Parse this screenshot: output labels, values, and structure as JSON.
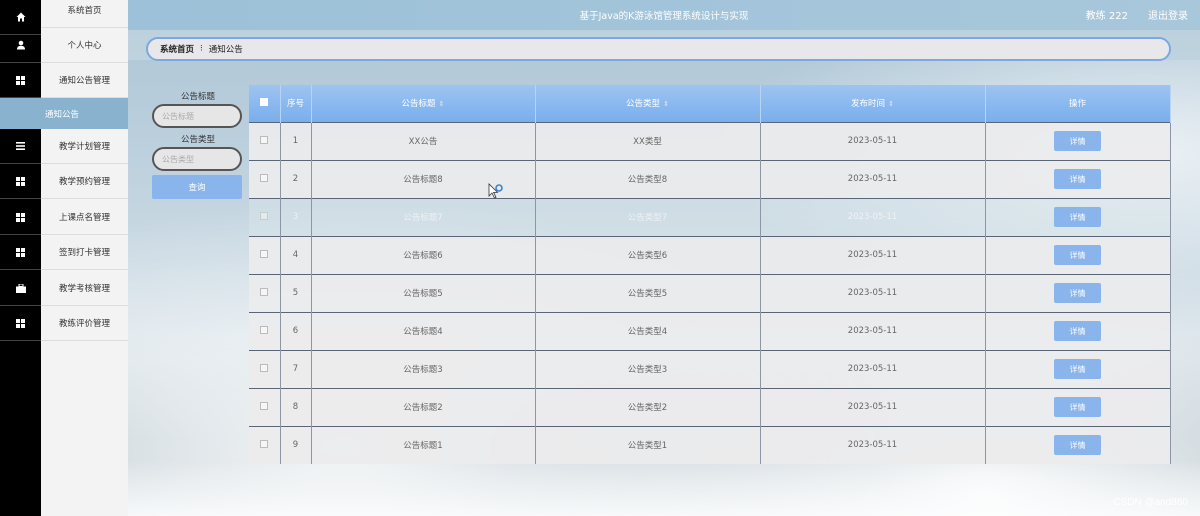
{
  "header": {
    "title": "基于Java的K游泳馆管理系统设计与实现",
    "user": "教练 222",
    "logout": "退出登录"
  },
  "sidebar": {
    "items": [
      {
        "label": "系统首页",
        "icon": "home-icon"
      },
      {
        "label": "个人中心",
        "icon": "user-icon"
      },
      {
        "label": "通知公告管理",
        "icon": "grid-icon"
      },
      {
        "label": "教学计划管理",
        "icon": "list-icon"
      },
      {
        "label": "教学预约管理",
        "icon": "grid-icon"
      },
      {
        "label": "上课点名管理",
        "icon": "grid-icon"
      },
      {
        "label": "签到打卡管理",
        "icon": "grid-icon"
      },
      {
        "label": "教学考核管理",
        "icon": "briefcase-icon"
      },
      {
        "label": "教练评价管理",
        "icon": "grid-icon"
      }
    ],
    "active_sub": "通知公告"
  },
  "breadcrumb": {
    "home": "系统首页",
    "current": "通知公告"
  },
  "search": {
    "title_label": "公告标题",
    "title_placeholder": "公告标题",
    "type_label": "公告类型",
    "type_placeholder": "公告类型",
    "query_button": "查询"
  },
  "table": {
    "columns": [
      "序号",
      "公告标题",
      "公告类型",
      "发布时间",
      "操作"
    ],
    "rows": [
      {
        "no": "1",
        "title": "XX公告",
        "type": "XX类型",
        "time": "2023-05-11",
        "action": "详情"
      },
      {
        "no": "2",
        "title": "公告标题8",
        "type": "公告类型8",
        "time": "2023-05-11",
        "action": "详情"
      },
      {
        "no": "3",
        "title": "公告标题7",
        "type": "公告类型7",
        "time": "2023-05-11",
        "action": "详情"
      },
      {
        "no": "4",
        "title": "公告标题6",
        "type": "公告类型6",
        "time": "2023-05-11",
        "action": "详情"
      },
      {
        "no": "5",
        "title": "公告标题5",
        "type": "公告类型5",
        "time": "2023-05-11",
        "action": "详情"
      },
      {
        "no": "6",
        "title": "公告标题4",
        "type": "公告类型4",
        "time": "2023-05-11",
        "action": "详情"
      },
      {
        "no": "7",
        "title": "公告标题3",
        "type": "公告类型3",
        "time": "2023-05-11",
        "action": "详情"
      },
      {
        "no": "8",
        "title": "公告标题2",
        "type": "公告类型2",
        "time": "2023-05-11",
        "action": "详情"
      },
      {
        "no": "9",
        "title": "公告标题1",
        "type": "公告类型1",
        "time": "2023-05-11",
        "action": "详情"
      }
    ]
  },
  "watermark": "CSDN @and860",
  "colors": {
    "header": "#9cc1d8",
    "active_item": "#89b2cf",
    "table_header": "#79aeed",
    "button": "#8ab4ec",
    "breadcrumb_border": "#7da7e0"
  }
}
